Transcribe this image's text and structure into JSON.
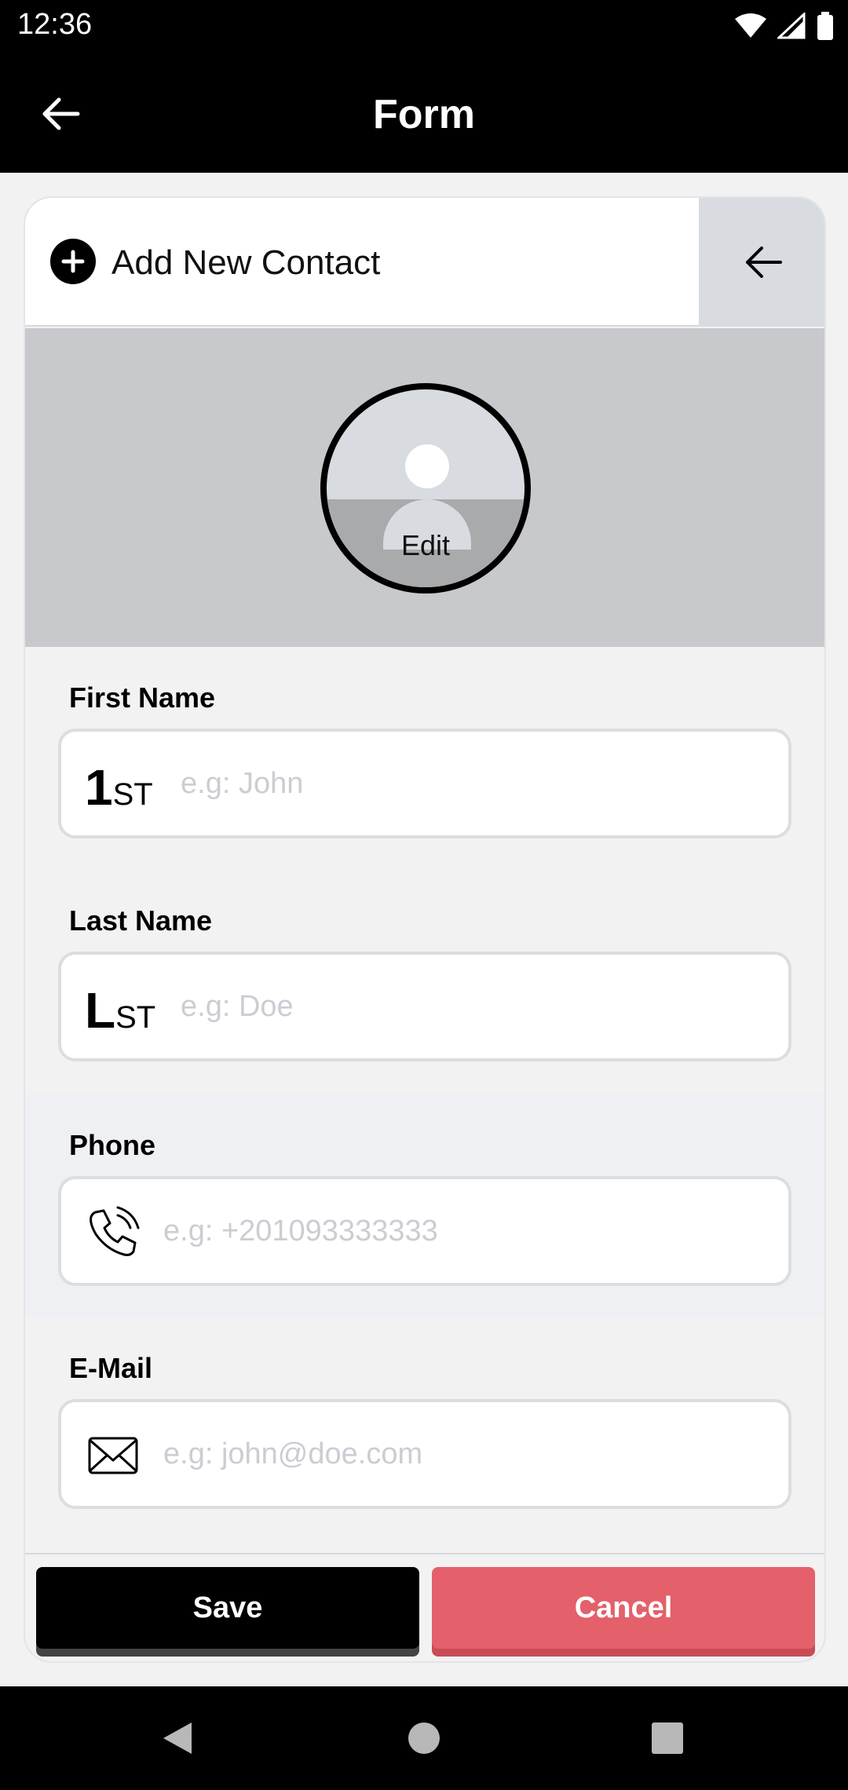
{
  "status_bar": {
    "time": "12:36"
  },
  "app_bar": {
    "title": "Form"
  },
  "card": {
    "header_title": "Add New Contact",
    "avatar_edit_label": "Edit"
  },
  "fields": {
    "first_name": {
      "label": "First Name",
      "prefix_big": "1",
      "prefix_small": "ST",
      "placeholder": "e.g: John",
      "value": ""
    },
    "last_name": {
      "label": "Last Name",
      "prefix_big": "L",
      "prefix_small": "ST",
      "placeholder": "e.g: Doe",
      "value": ""
    },
    "phone": {
      "label": "Phone",
      "icon": "phone-icon",
      "placeholder": "e.g: +201093333333",
      "value": ""
    },
    "email": {
      "label": "E-Mail",
      "icon": "envelope-icon",
      "placeholder": "e.g: john@doe.com",
      "value": ""
    }
  },
  "buttons": {
    "save_label": "Save",
    "cancel_label": "Cancel"
  },
  "colors": {
    "cancel": "#e4606a",
    "save": "#000000",
    "phone_section_bg": "#eff0f4"
  }
}
